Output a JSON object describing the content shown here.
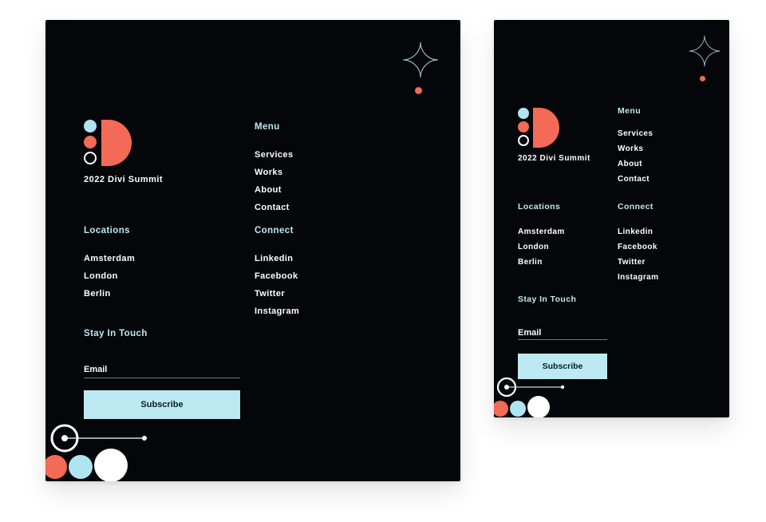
{
  "tagline": "2022 Divi Summit",
  "headings": {
    "menu": "Menu",
    "locations": "Locations",
    "connect": "Connect",
    "stay": "Stay In Touch"
  },
  "menu": {
    "items": [
      "Services",
      "Works",
      "About",
      "Contact"
    ]
  },
  "locations": {
    "items": [
      "Amsterdam",
      "London",
      "Berlin"
    ]
  },
  "connect": {
    "items": [
      "Linkedin",
      "Facebook",
      "Twitter",
      "Instagram"
    ]
  },
  "subscribe": {
    "email_label": "Email",
    "button": "Subscribe"
  }
}
